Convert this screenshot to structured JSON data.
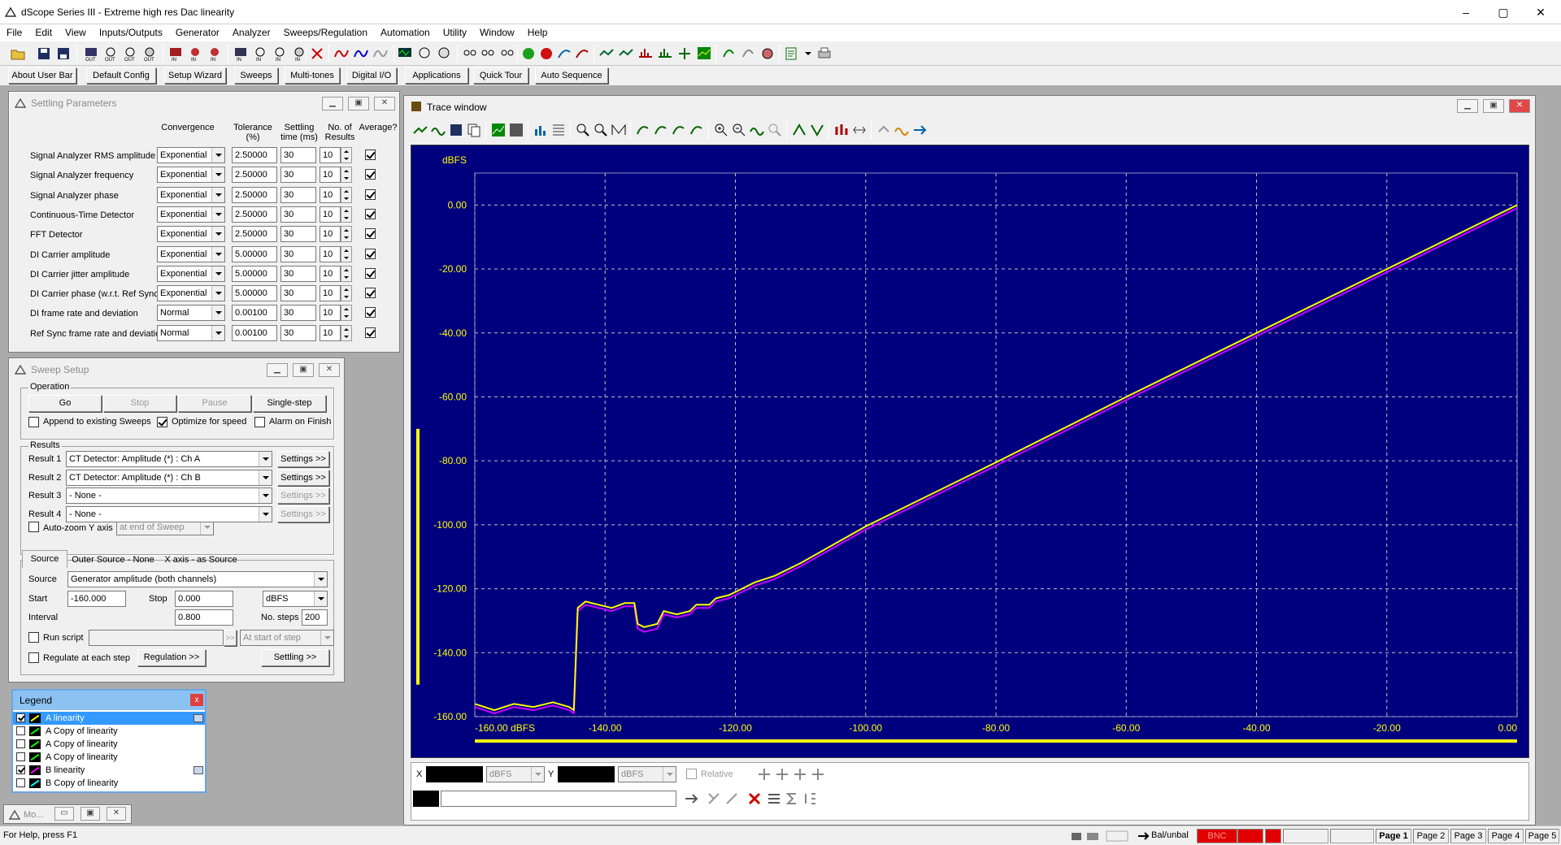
{
  "window": {
    "title": "dScope Series III - Extreme high res  Dac linearity",
    "controls": [
      "–",
      "▢",
      "✕"
    ]
  },
  "menu": [
    "File",
    "Edit",
    "View",
    "Inputs/Outputs",
    "Generator",
    "Analyzer",
    "Sweeps/Regulation",
    "Automation",
    "Utility",
    "Window",
    "Help"
  ],
  "userbar": [
    "About User Bar",
    "Default Config",
    "Setup Wizard",
    "Sweeps",
    "Multi-tones",
    "Digital I/O",
    "Applications",
    "Quick Tour",
    "Auto Sequence"
  ],
  "settling": {
    "title": "Settling Parameters",
    "headers": {
      "convergence": "Convergence",
      "tolerance": "Tolerance (%)",
      "settling": "Settling time (ms)",
      "results": "No. of Results",
      "average": "Average?"
    },
    "rows": [
      {
        "label": "Signal Analyzer RMS amplitude",
        "conv": "Exponential",
        "tol": "2.50000",
        "time": "30",
        "n": "10",
        "avg": true
      },
      {
        "label": "Signal Analyzer frequency",
        "conv": "Exponential",
        "tol": "2.50000",
        "time": "30",
        "n": "10",
        "avg": true
      },
      {
        "label": "Signal Analyzer phase",
        "conv": "Exponential",
        "tol": "2.50000",
        "time": "30",
        "n": "10",
        "avg": true
      },
      {
        "label": "Continuous-Time Detector",
        "conv": "Exponential",
        "tol": "2.50000",
        "time": "30",
        "n": "10",
        "avg": true
      },
      {
        "label": "FFT Detector",
        "conv": "Exponential",
        "tol": "2.50000",
        "time": "30",
        "n": "10",
        "avg": true
      },
      {
        "label": "DI Carrier amplitude",
        "conv": "Exponential",
        "tol": "5.00000",
        "time": "30",
        "n": "10",
        "avg": true
      },
      {
        "label": "DI Carrier jitter amplitude",
        "conv": "Exponential",
        "tol": "5.00000",
        "time": "30",
        "n": "10",
        "avg": true
      },
      {
        "label": "DI Carrier phase (w.r.t. Ref Sync)",
        "conv": "Exponential",
        "tol": "5.00000",
        "time": "30",
        "n": "10",
        "avg": true
      },
      {
        "label": "DI frame rate and deviation",
        "conv": "Normal",
        "tol": "0.00100",
        "time": "30",
        "n": "10",
        "avg": true
      },
      {
        "label": "Ref Sync frame rate and deviation",
        "conv": "Normal",
        "tol": "0.00100",
        "time": "30",
        "n": "10",
        "avg": true
      }
    ]
  },
  "sweep": {
    "title": "Sweep Setup",
    "operation_label": "Operation",
    "buttons": {
      "go": "Go",
      "stop": "Stop",
      "pause": "Pause",
      "single": "Single-step"
    },
    "append": "Append to existing Sweeps",
    "optimize": "Optimize for speed",
    "alarm": "Alarm on Finish",
    "results_label": "Results",
    "results": [
      {
        "label": "Result 1",
        "value": "CT Detector: Amplitude (*) : Ch A",
        "settings": "Settings >>",
        "enabled": true
      },
      {
        "label": "Result 2",
        "value": "CT Detector: Amplitude (*) : Ch B",
        "settings": "Settings >>",
        "enabled": true
      },
      {
        "label": "Result 3",
        "value": "- None -",
        "settings": "Settings >>",
        "enabled": false
      },
      {
        "label": "Result 4",
        "value": "- None -",
        "settings": "Settings >>",
        "enabled": false
      }
    ],
    "autozoom": "Auto-zoom Y axis",
    "autozoom_when": "at end of Sweep",
    "tabs": [
      "Source",
      "Outer Source - None",
      "X axis - as Source"
    ],
    "source_label": "Source",
    "source_value": "Generator amplitude (both channels)",
    "start_label": "Start",
    "start_value": "-160.000",
    "stop_label": "Stop",
    "stop_value": "0.000",
    "unit": "dBFS",
    "interval_label": "Interval",
    "interval_value": "0.800",
    "steps_label": "No. steps",
    "steps_value": "200",
    "run_script": "Run script",
    "script_more": ">>",
    "script_when": "At start of step",
    "regulate": "Regulate at each step",
    "regulation_btn": "Regulation >>",
    "settling_btn": "Settling >>"
  },
  "legend": {
    "title": "Legend",
    "close": "x",
    "items": [
      {
        "label": "A linearity",
        "checked": true,
        "color": "#ffff00",
        "selected": true
      },
      {
        "label": "A Copy of linearity",
        "checked": false,
        "color": "#00ff00",
        "selected": false
      },
      {
        "label": "A Copy of linearity",
        "checked": false,
        "color": "#00ff00",
        "selected": false
      },
      {
        "label": "A Copy of linearity",
        "checked": false,
        "color": "#00ff00",
        "selected": false
      },
      {
        "label": "B linearity",
        "checked": true,
        "color": "#ff00ff",
        "selected": false
      },
      {
        "label": "B Copy of linearity",
        "checked": false,
        "color": "#00ffff",
        "selected": false
      }
    ]
  },
  "minimized": {
    "title": "Mo..."
  },
  "trace": {
    "title": "Trace window",
    "x_label_unit": "dBFS",
    "x_readout_label": "X",
    "y_readout_label": "Y",
    "x_unit": "dBFS",
    "y_unit": "dBFS",
    "relative": "Relative"
  },
  "chart_data": {
    "type": "line",
    "title": "",
    "ylabel": "dBFS",
    "xlabel": "",
    "xlim": [
      -160,
      0
    ],
    "ylim": [
      -160,
      10
    ],
    "grid": true,
    "x_ticks": [
      "-160.00 dBFS",
      "-140.00",
      "-120.00",
      "-100.00",
      "-80.00",
      "-60.00",
      "-40.00",
      "-20.00",
      "0.00"
    ],
    "y_ticks": [
      "0.00",
      "-20.00",
      "-40.00",
      "-60.00",
      "-80.00",
      "-100.00",
      "-120.00",
      "-140.00",
      "-160.00"
    ],
    "colors": {
      "background": "#00007f",
      "grid": "#c0c0c0",
      "text": "#ffff00",
      "A": "#ffff00",
      "B": "#cc00ff"
    },
    "series": [
      {
        "name": "A linearity",
        "color": "#ffff00",
        "points": [
          [
            -160,
            -156
          ],
          [
            -157,
            -158
          ],
          [
            -154,
            -156
          ],
          [
            -151,
            -157
          ],
          [
            -148,
            -155.5
          ],
          [
            -145.5,
            -157
          ],
          [
            -144.8,
            -158
          ],
          [
            -144.2,
            -126
          ],
          [
            -143,
            -124
          ],
          [
            -141,
            -125
          ],
          [
            -139,
            -126
          ],
          [
            -137,
            -124.5
          ],
          [
            -135.5,
            -124.5
          ],
          [
            -135,
            -131
          ],
          [
            -134,
            -132
          ],
          [
            -132,
            -131
          ],
          [
            -131,
            -127
          ],
          [
            -129,
            -128
          ],
          [
            -127,
            -127
          ],
          [
            -126,
            -125
          ],
          [
            -124,
            -125
          ],
          [
            -123,
            -123
          ],
          [
            -121,
            -122
          ],
          [
            -119,
            -120
          ],
          [
            -117,
            -118
          ],
          [
            -114,
            -116
          ],
          [
            -110,
            -112
          ],
          [
            -100,
            -100.5
          ],
          [
            -80,
            -80.5
          ],
          [
            -60,
            -60
          ],
          [
            -40,
            -40
          ],
          [
            -20,
            -20
          ],
          [
            0,
            0
          ]
        ]
      },
      {
        "name": "B linearity",
        "color": "#cc00ff",
        "points": [
          [
            -160,
            -157
          ],
          [
            -157,
            -159
          ],
          [
            -154,
            -157
          ],
          [
            -151,
            -158
          ],
          [
            -148,
            -156.5
          ],
          [
            -145.5,
            -158
          ],
          [
            -144.8,
            -159
          ],
          [
            -144.2,
            -127
          ],
          [
            -143,
            -125
          ],
          [
            -141,
            -126
          ],
          [
            -139,
            -127
          ],
          [
            -137,
            -125.5
          ],
          [
            -135.5,
            -125.5
          ],
          [
            -135,
            -132.5
          ],
          [
            -134,
            -133.5
          ],
          [
            -132,
            -132.5
          ],
          [
            -131,
            -128
          ],
          [
            -129,
            -129
          ],
          [
            -127,
            -128
          ],
          [
            -126,
            -126
          ],
          [
            -124,
            -126
          ],
          [
            -123,
            -124
          ],
          [
            -121,
            -123
          ],
          [
            -119,
            -121
          ],
          [
            -117,
            -119
          ],
          [
            -114,
            -117
          ],
          [
            -110,
            -113
          ],
          [
            -100,
            -101.5
          ],
          [
            -80,
            -81.5
          ],
          [
            -60,
            -61
          ],
          [
            -40,
            -41
          ],
          [
            -20,
            -21
          ],
          [
            0,
            -1
          ]
        ]
      }
    ]
  },
  "status": {
    "help": "For Help, press F1",
    "balunbal": "Bal/unbal",
    "bnc": "BNC",
    "pages": [
      "Page 1",
      "Page 2",
      "Page 3",
      "Page 4",
      "Page 5"
    ]
  }
}
